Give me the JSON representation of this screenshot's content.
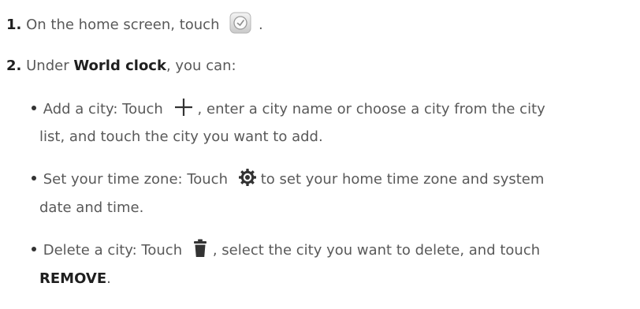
{
  "steps": [
    {
      "number": "1.",
      "text_before": "On the home screen, touch",
      "text_after": "."
    },
    {
      "number": "2.",
      "text_before": "Under",
      "bold": "World clock",
      "text_after": ", you can:"
    }
  ],
  "bullets": {
    "add_city": {
      "before": "Add a city: Touch",
      "after": ", enter a city name or choose a city from the city",
      "cont": "list, and touch the city you want to add."
    },
    "time_zone": {
      "before": "Set your time zone: Touch",
      "after": "to set your home time zone and system",
      "cont": "date and time."
    },
    "delete_city": {
      "before": "Delete a city: Touch",
      "after": ", select the city you want to delete, and touch",
      "cont_bold": "REMOVE",
      "cont_after": "."
    }
  },
  "icons": {
    "clock": "clock-app-icon",
    "add": "plus-icon",
    "settings": "gear-icon",
    "delete": "trash-icon"
  },
  "colors": {
    "body_text": "#595959",
    "strong_text": "#1f1f1f"
  }
}
